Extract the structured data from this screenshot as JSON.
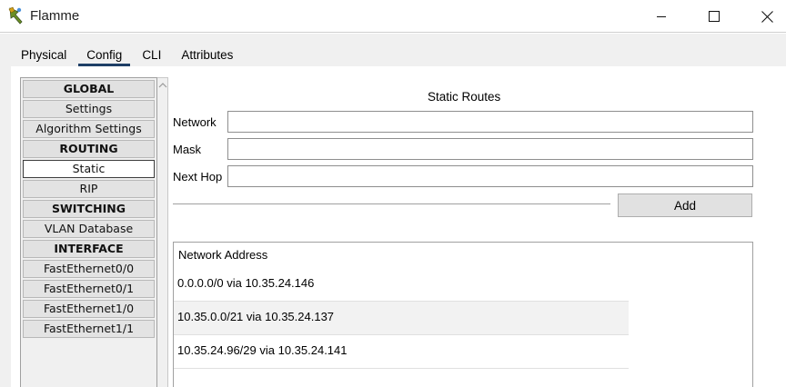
{
  "window": {
    "title": "Flamme"
  },
  "tabs": [
    {
      "label": "Physical"
    },
    {
      "label": "Config",
      "active": true
    },
    {
      "label": "CLI"
    },
    {
      "label": "Attributes"
    }
  ],
  "nav": {
    "items": [
      {
        "label": "GLOBAL",
        "type": "header"
      },
      {
        "label": "Settings"
      },
      {
        "label": "Algorithm Settings"
      },
      {
        "label": "ROUTING",
        "type": "header"
      },
      {
        "label": "Static",
        "selected": true
      },
      {
        "label": "RIP"
      },
      {
        "label": "SWITCHING",
        "type": "header"
      },
      {
        "label": "VLAN Database"
      },
      {
        "label": "INTERFACE",
        "type": "header"
      },
      {
        "label": "FastEthernet0/0"
      },
      {
        "label": "FastEthernet0/1"
      },
      {
        "label": "FastEthernet1/0"
      },
      {
        "label": "FastEthernet1/1"
      }
    ]
  },
  "static_routes": {
    "heading": "Static Routes",
    "network_label": "Network",
    "network_value": "",
    "mask_label": "Mask",
    "mask_value": "",
    "next_hop_label": "Next Hop",
    "next_hop_value": "",
    "add_label": "Add"
  },
  "routes_table": {
    "header": "Network Address",
    "rows": [
      "0.0.0.0/0 via 10.35.24.146",
      "10.35.0.0/21 via 10.35.24.137",
      "10.35.24.96/29 via 10.35.24.141"
    ]
  },
  "colors": {
    "tab_underline": "#1e3f66",
    "nav_background": "#f0f0f0",
    "frame_background": "#f0f0f0"
  }
}
